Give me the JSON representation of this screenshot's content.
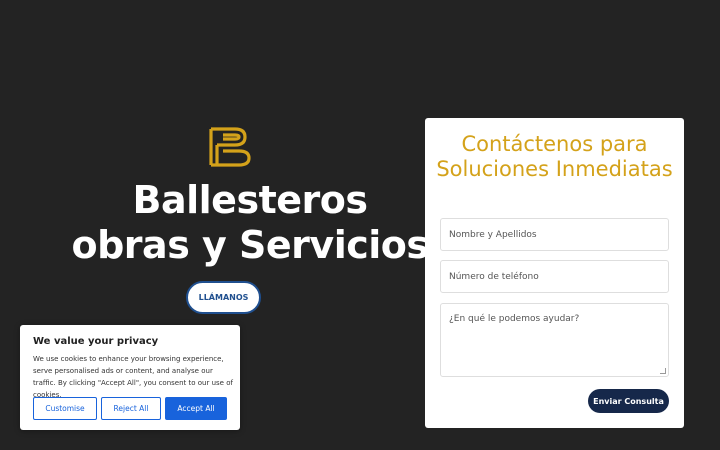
{
  "hero": {
    "logo": "ballesteros-b-logo",
    "title": "Ballesteros obras y Servicios",
    "call_button": "LLÁMANOS"
  },
  "contact_form": {
    "title": "Contáctenos para Soluciones Inmediatas",
    "name_placeholder": "Nombre y Apellidos",
    "phone_placeholder": "Número de teléfono",
    "message_placeholder": "¿En qué le podemos ayudar?",
    "submit_label": "Enviar Consulta"
  },
  "cookie_banner": {
    "title": "We value your privacy",
    "text": "We use cookies to enhance your browsing experience, serve personalised ads or content, and analyse our traffic. By clicking \"Accept All\", you consent to our use of cookies.",
    "customise_label": "Customise",
    "reject_label": "Reject All",
    "accept_label": "Accept All"
  },
  "colors": {
    "background": "#232323",
    "gold": "#d4a21a",
    "navy": "#16284a",
    "cookie_blue": "#1863dc"
  }
}
